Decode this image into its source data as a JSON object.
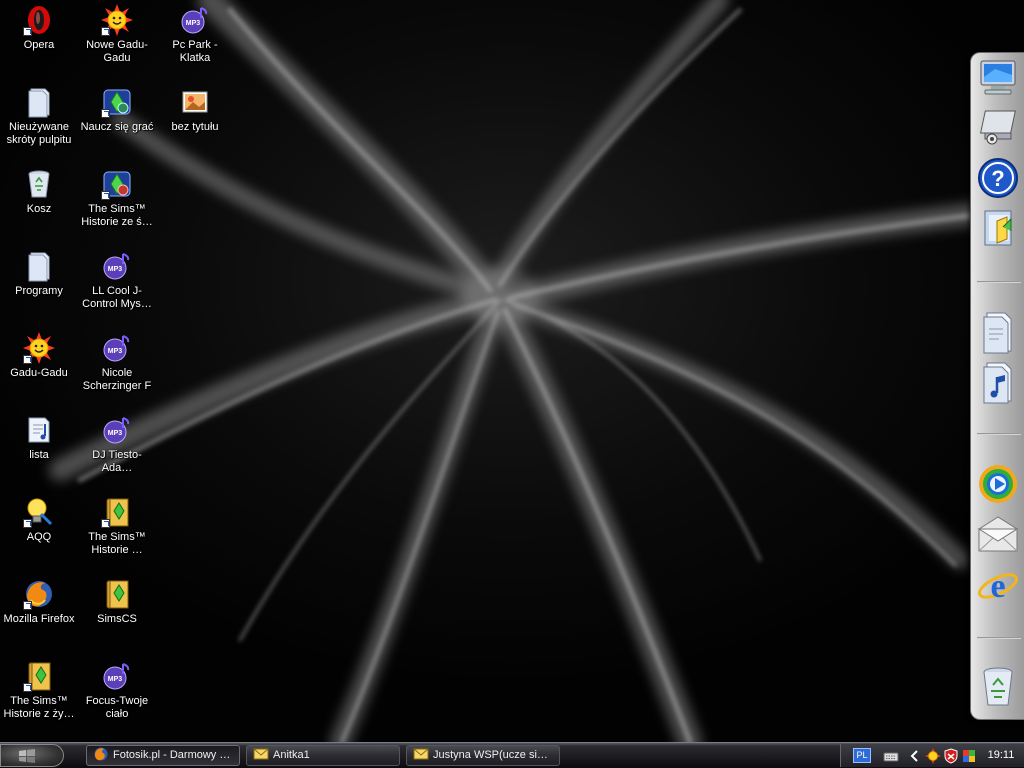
{
  "desktop": {
    "icons": [
      {
        "label": "Opera",
        "icon": "opera-icon",
        "shortcut": true
      },
      {
        "label": "Nowe Gadu-Gadu",
        "icon": "gadu-gadu-sun-icon",
        "shortcut": true
      },
      {
        "label": "Pc Park - Klatka",
        "icon": "mp3-file-icon",
        "shortcut": false
      },
      {
        "label": "Nieużywane skróty pulpitu",
        "icon": "folder-icon",
        "shortcut": false
      },
      {
        "label": "Naucz się grać",
        "icon": "game-app-icon",
        "shortcut": true
      },
      {
        "label": "bez tytułu",
        "icon": "image-file-icon",
        "shortcut": false
      },
      {
        "label": "Kosz",
        "icon": "recycle-bin-icon",
        "shortcut": false
      },
      {
        "label": "The Sims™ Historie ze ś…",
        "icon": "game-app-icon",
        "shortcut": true
      },
      {
        "label": "Programy",
        "icon": "folder-icon",
        "shortcut": false
      },
      {
        "label": "LL Cool J-Control Mys…",
        "icon": "mp3-file-icon",
        "shortcut": false
      },
      {
        "label": "Gadu-Gadu",
        "icon": "gadu-gadu-sun-icon",
        "shortcut": true
      },
      {
        "label": "Nicole Scherzinger F",
        "icon": "mp3-file-icon",
        "shortcut": false
      },
      {
        "label": "lista",
        "icon": "playlist-icon",
        "shortcut": false
      },
      {
        "label": "DJ Tiesto-Ada…",
        "icon": "mp3-file-icon",
        "shortcut": false
      },
      {
        "label": "AQQ",
        "icon": "aqq-bulb-icon",
        "shortcut": true
      },
      {
        "label": "The Sims™ Historie …",
        "icon": "sims-book-icon",
        "shortcut": true
      },
      {
        "label": "Mozilla Firefox",
        "icon": "firefox-icon",
        "shortcut": true
      },
      {
        "label": "SimsCS",
        "icon": "sims-book-icon",
        "shortcut": false
      },
      {
        "label": "The Sims™ Historie z ży…",
        "icon": "sims-book-icon",
        "shortcut": true
      },
      {
        "label": "Focus-Twoje ciało",
        "icon": "mp3-file-icon",
        "shortcut": false
      }
    ]
  },
  "dock": {
    "items": [
      {
        "name": "my-computer-icon"
      },
      {
        "name": "control-panel-icon"
      },
      {
        "name": "help-icon"
      },
      {
        "name": "explorer-folder-icon"
      },
      {
        "name": "documents-icon"
      },
      {
        "name": "music-folder-icon"
      },
      {
        "name": "media-player-icon"
      },
      {
        "name": "mail-icon"
      },
      {
        "name": "internet-explorer-icon"
      },
      {
        "name": "recycle-bin-icon"
      }
    ]
  },
  "taskbar": {
    "tasks": [
      {
        "label": "Fotosik.pl - Darmowy …",
        "icon": "firefox-icon",
        "active": true
      },
      {
        "label": "Anitka1",
        "icon": "envelope-icon",
        "active": false
      },
      {
        "label": "Justyna WSP(ucze si…",
        "icon": "envelope-icon",
        "active": false
      }
    ],
    "tray": {
      "language": "PL",
      "clock": "19:11",
      "icons": [
        "keyboard-icon",
        "chevron-left-icon",
        "gadu-gadu-sun-icon",
        "shield-icon",
        "flag-color-icon"
      ]
    }
  }
}
